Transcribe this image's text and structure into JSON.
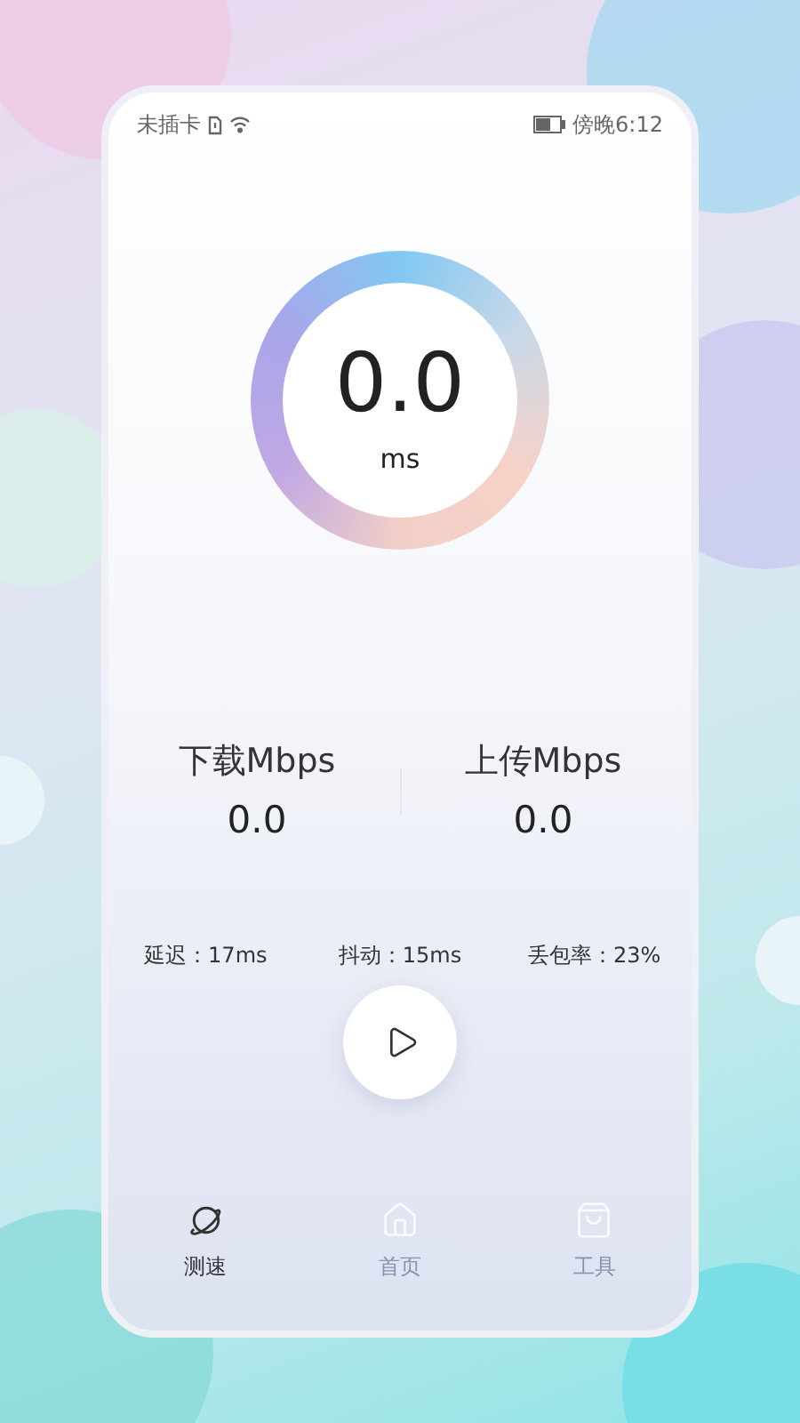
{
  "status_bar": {
    "carrier": "未插卡",
    "time": "傍晚6:12"
  },
  "latency": {
    "value": "0.0",
    "unit": "ms"
  },
  "speeds": [
    {
      "label": "下载Mbps",
      "value": "0.0"
    },
    {
      "label": "上传Mbps",
      "value": "0.0"
    }
  ],
  "stats": [
    "延迟：17ms",
    "抖动：15ms",
    "丢包率：23%"
  ],
  "tabs": [
    {
      "label": "测速",
      "selected": true,
      "kind": "planet"
    },
    {
      "label": "首页",
      "selected": false,
      "kind": "home"
    },
    {
      "label": "工具",
      "selected": false,
      "kind": "bag"
    }
  ]
}
